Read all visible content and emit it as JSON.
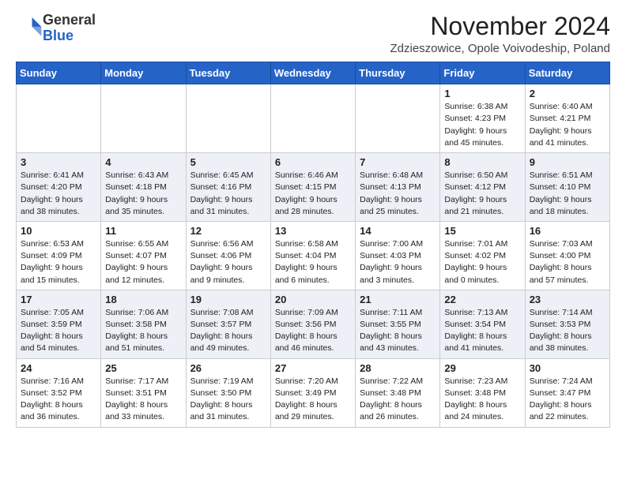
{
  "header": {
    "logo_general": "General",
    "logo_blue": "Blue",
    "month_title": "November 2024",
    "location": "Zdzieszowice, Opole Voivodeship, Poland"
  },
  "weekdays": [
    "Sunday",
    "Monday",
    "Tuesday",
    "Wednesday",
    "Thursday",
    "Friday",
    "Saturday"
  ],
  "weeks": [
    [
      {
        "day": "",
        "info": ""
      },
      {
        "day": "",
        "info": ""
      },
      {
        "day": "",
        "info": ""
      },
      {
        "day": "",
        "info": ""
      },
      {
        "day": "",
        "info": ""
      },
      {
        "day": "1",
        "info": "Sunrise: 6:38 AM\nSunset: 4:23 PM\nDaylight: 9 hours\nand 45 minutes."
      },
      {
        "day": "2",
        "info": "Sunrise: 6:40 AM\nSunset: 4:21 PM\nDaylight: 9 hours\nand 41 minutes."
      }
    ],
    [
      {
        "day": "3",
        "info": "Sunrise: 6:41 AM\nSunset: 4:20 PM\nDaylight: 9 hours\nand 38 minutes."
      },
      {
        "day": "4",
        "info": "Sunrise: 6:43 AM\nSunset: 4:18 PM\nDaylight: 9 hours\nand 35 minutes."
      },
      {
        "day": "5",
        "info": "Sunrise: 6:45 AM\nSunset: 4:16 PM\nDaylight: 9 hours\nand 31 minutes."
      },
      {
        "day": "6",
        "info": "Sunrise: 6:46 AM\nSunset: 4:15 PM\nDaylight: 9 hours\nand 28 minutes."
      },
      {
        "day": "7",
        "info": "Sunrise: 6:48 AM\nSunset: 4:13 PM\nDaylight: 9 hours\nand 25 minutes."
      },
      {
        "day": "8",
        "info": "Sunrise: 6:50 AM\nSunset: 4:12 PM\nDaylight: 9 hours\nand 21 minutes."
      },
      {
        "day": "9",
        "info": "Sunrise: 6:51 AM\nSunset: 4:10 PM\nDaylight: 9 hours\nand 18 minutes."
      }
    ],
    [
      {
        "day": "10",
        "info": "Sunrise: 6:53 AM\nSunset: 4:09 PM\nDaylight: 9 hours\nand 15 minutes."
      },
      {
        "day": "11",
        "info": "Sunrise: 6:55 AM\nSunset: 4:07 PM\nDaylight: 9 hours\nand 12 minutes."
      },
      {
        "day": "12",
        "info": "Sunrise: 6:56 AM\nSunset: 4:06 PM\nDaylight: 9 hours\nand 9 minutes."
      },
      {
        "day": "13",
        "info": "Sunrise: 6:58 AM\nSunset: 4:04 PM\nDaylight: 9 hours\nand 6 minutes."
      },
      {
        "day": "14",
        "info": "Sunrise: 7:00 AM\nSunset: 4:03 PM\nDaylight: 9 hours\nand 3 minutes."
      },
      {
        "day": "15",
        "info": "Sunrise: 7:01 AM\nSunset: 4:02 PM\nDaylight: 9 hours\nand 0 minutes."
      },
      {
        "day": "16",
        "info": "Sunrise: 7:03 AM\nSunset: 4:00 PM\nDaylight: 8 hours\nand 57 minutes."
      }
    ],
    [
      {
        "day": "17",
        "info": "Sunrise: 7:05 AM\nSunset: 3:59 PM\nDaylight: 8 hours\nand 54 minutes."
      },
      {
        "day": "18",
        "info": "Sunrise: 7:06 AM\nSunset: 3:58 PM\nDaylight: 8 hours\nand 51 minutes."
      },
      {
        "day": "19",
        "info": "Sunrise: 7:08 AM\nSunset: 3:57 PM\nDaylight: 8 hours\nand 49 minutes."
      },
      {
        "day": "20",
        "info": "Sunrise: 7:09 AM\nSunset: 3:56 PM\nDaylight: 8 hours\nand 46 minutes."
      },
      {
        "day": "21",
        "info": "Sunrise: 7:11 AM\nSunset: 3:55 PM\nDaylight: 8 hours\nand 43 minutes."
      },
      {
        "day": "22",
        "info": "Sunrise: 7:13 AM\nSunset: 3:54 PM\nDaylight: 8 hours\nand 41 minutes."
      },
      {
        "day": "23",
        "info": "Sunrise: 7:14 AM\nSunset: 3:53 PM\nDaylight: 8 hours\nand 38 minutes."
      }
    ],
    [
      {
        "day": "24",
        "info": "Sunrise: 7:16 AM\nSunset: 3:52 PM\nDaylight: 8 hours\nand 36 minutes."
      },
      {
        "day": "25",
        "info": "Sunrise: 7:17 AM\nSunset: 3:51 PM\nDaylight: 8 hours\nand 33 minutes."
      },
      {
        "day": "26",
        "info": "Sunrise: 7:19 AM\nSunset: 3:50 PM\nDaylight: 8 hours\nand 31 minutes."
      },
      {
        "day": "27",
        "info": "Sunrise: 7:20 AM\nSunset: 3:49 PM\nDaylight: 8 hours\nand 29 minutes."
      },
      {
        "day": "28",
        "info": "Sunrise: 7:22 AM\nSunset: 3:48 PM\nDaylight: 8 hours\nand 26 minutes."
      },
      {
        "day": "29",
        "info": "Sunrise: 7:23 AM\nSunset: 3:48 PM\nDaylight: 8 hours\nand 24 minutes."
      },
      {
        "day": "30",
        "info": "Sunrise: 7:24 AM\nSunset: 3:47 PM\nDaylight: 8 hours\nand 22 minutes."
      }
    ]
  ]
}
